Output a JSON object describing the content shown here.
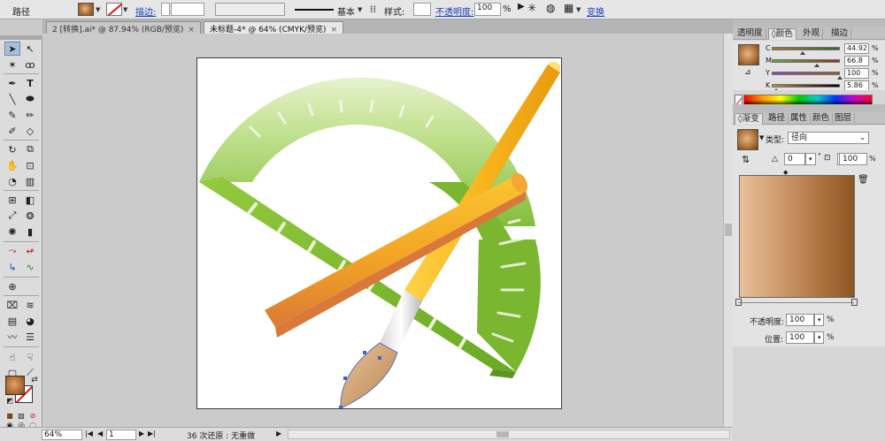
{
  "control_bar": {
    "object_type": "路径",
    "stroke_link": "描边:",
    "stroke_weight": "",
    "brush_profile": "基本",
    "style_label": "样式:",
    "opacity_link": "不透明度:",
    "opacity_value": "100",
    "opacity_unit": "%",
    "transform_link": "变换",
    "icons": [
      "fill-swatch",
      "stroke-none-swatch",
      "chevron-down-icon",
      "align-icon",
      "recolor-icon",
      "globe-icon",
      "grid-icon"
    ]
  },
  "doc_tabs": [
    {
      "label": "2 [转换].ai* @ 87.94% (RGB/预览)",
      "close": "×",
      "active": false
    },
    {
      "label": "未标题-4* @ 64% (CMYK/预览)",
      "close": "×",
      "active": true
    }
  ],
  "tools": [
    "selection-tool",
    "direct-selection-tool",
    "magic-wand-tool",
    "lasso-tool",
    "pen-tool",
    "type-tool",
    "line-tool",
    "ellipse-tool",
    "paintbrush-tool",
    "pencil-tool",
    "blob-brush-tool",
    "eraser-tool",
    "rotate-tool",
    "scale-tool",
    "warp-tool",
    "free-transform-tool",
    "shape-builder-tool",
    "perspective-grid-tool",
    "mesh-tool",
    "gradient-tool",
    "eyedropper-tool",
    "blend-tool",
    "symbol-sprayer-tool",
    "column-graph-tool",
    "anchor-tool-a",
    "anchor-tool-b",
    "anchor-tool-c",
    "anchor-tool-d",
    "globe-tool",
    "envelope-tool-a",
    "envelope-tool-b",
    "chart-tool-a",
    "chart-tool-b",
    "wave-tool",
    "list-tool",
    "puppet-tool",
    "puppet-tool-b",
    "artboard-tool",
    "slice-tool",
    "hand-tool",
    "zoom-tool"
  ],
  "status_bar": {
    "zoom": "64%",
    "page": "1",
    "history": "36 次还原 : 无重做",
    "play_icon": "▶"
  },
  "color_panel": {
    "tabs": [
      "透明度",
      "颜色",
      "外观",
      "描边"
    ],
    "active_tab": "颜色",
    "channels": [
      {
        "label": "C",
        "value": "44.92",
        "fraction": 0.4492,
        "gradient_end": "#2e6a3a"
      },
      {
        "label": "M",
        "value": "66.8",
        "fraction": 0.668,
        "gradient_end": "#8b3a1e"
      },
      {
        "label": "Y",
        "value": "100",
        "fraction": 1.0,
        "gradient_end": "#8b6a1e"
      },
      {
        "label": "K",
        "value": "5.86",
        "fraction": 0.0586,
        "gradient_end": "#000000"
      }
    ],
    "unit": "%"
  },
  "gradient_panel": {
    "tabs": [
      "渐变",
      "路径",
      "属性",
      "颜色",
      "图层"
    ],
    "active_tab": "渐变",
    "type_label": "类型:",
    "type_value": "径向",
    "angle_value": "0",
    "angle_unit": "°",
    "aspect_value": "100",
    "aspect_unit": "%",
    "opacity_label": "不透明度:",
    "opacity_value": "100",
    "position_label": "位置:",
    "position_value": "100",
    "unit": "%",
    "stops": [
      {
        "position": 0,
        "color": "#e8bf99"
      },
      {
        "position": 100,
        "color": "#8b5623"
      }
    ]
  },
  "colors": {
    "accent_link": "#1a3cb8",
    "ruler_green": "#8bc34a",
    "pencil_yellow": "#f5b01a",
    "ruler_orange": "#e8873a",
    "brush_tan": "#d2a679"
  }
}
